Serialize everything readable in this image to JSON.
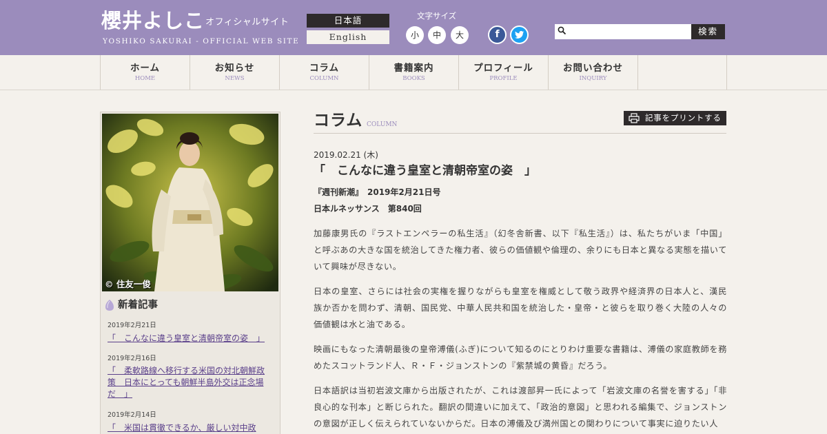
{
  "header": {
    "logo_main": "櫻井よしこ",
    "logo_sub": "オフィシャルサイト",
    "logo_en": "YOSHIKO SAKURAI - OFFICIAL WEB SITE",
    "lang_jp": "日本語",
    "lang_en": "English",
    "font_size_label": "文字サイズ",
    "font_small": "小",
    "font_medium": "中",
    "font_large": "大",
    "facebook_glyph": "f",
    "twitter_glyph": "t",
    "search_placeholder": "",
    "search_button": "検索",
    "colors": {
      "header_bg": "#9b8cbc",
      "dark": "#2e2a2b",
      "page_bg": "#f4f1ec"
    }
  },
  "nav": [
    {
      "jp": "ホーム",
      "en": "HOME"
    },
    {
      "jp": "お知らせ",
      "en": "NEWS"
    },
    {
      "jp": "コラム",
      "en": "COLUMN"
    },
    {
      "jp": "書籍案内",
      "en": "BOOKS"
    },
    {
      "jp": "プロフィール",
      "en": "PROFILE"
    },
    {
      "jp": "お問い合わせ",
      "en": "INQUIRY"
    }
  ],
  "sidebar": {
    "photo_credit": "© 住友一俊",
    "news_heading": "新着記事",
    "news": [
      {
        "date": "2019年2月21日",
        "lines": [
          "「　こんなに違う皇室と清朝帝室の姿　」"
        ]
      },
      {
        "date": "2019年2月16日",
        "lines": [
          "「　柔軟路線へ移行する米国の対北朝鮮政",
          "策　日本にとっても朝鮮半島外交は正念場",
          "だ　」"
        ]
      },
      {
        "date": "2019年2月14日",
        "lines": [
          "「　米国は貫徹できるか、厳しい対中政"
        ]
      }
    ]
  },
  "main": {
    "section_title": "コラム",
    "section_title_en": "COLUMN",
    "print_label": "記事をプリントする",
    "article": {
      "date": "2019.02.21 (木)",
      "title": "「　こんなに違う皇室と清朝帝室の姿　」",
      "meta1": "『週刊新潮』　2019年2月21日号",
      "meta2": "日本ルネッサンス　第840回",
      "paragraphs": [
        "加藤康男氏の『ラストエンペラーの私生活』（幻冬舎新書、以下『私生活』）は、私たちがいま「中国」と呼ぶあの大きな国を統治してきた権力者、彼らの価値観や倫理の、余りにも日本と異なる実態を描いていて興味が尽きない。",
        "日本の皇室、さらには社会の実権を握りながらも皇室を権威として敬う政界や経済界の日本人と、漢民族か否かを問わず、清朝、国民党、中華人民共和国を統治した・皇帝・と彼らを取り巻く大陸の人々の価値観は水と油である。",
        "映画にもなった清朝最後の皇帝溥儀(ふぎ)について知るのにとりわけ重要な書籍は、溥儀の家庭教師を務めたスコットランド人、Ｒ・Ｆ・ジョンストンの『紫禁城の黄昏』だろう。",
        "日本語訳は当初岩波文庫から出版されたが、これは渡部昇一氏によって「岩波文庫の名誉を害する」「非良心的な刊本」と断じられた。翻訳の間違いに加えて、「政治的意図」と思われる編集で、ジョンストンの意図が正しく伝えられていないからだ。日本の溥儀及び満州国との関わりについて事実に迫りたい人"
      ]
    }
  }
}
